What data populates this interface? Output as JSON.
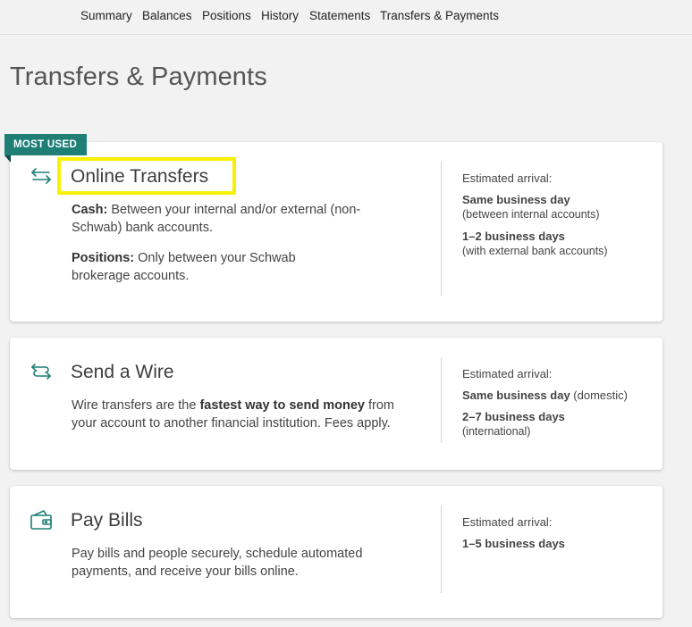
{
  "nav": {
    "items": [
      {
        "label": "Summary"
      },
      {
        "label": "Balances"
      },
      {
        "label": "Positions"
      },
      {
        "label": "History"
      },
      {
        "label": "Statements"
      },
      {
        "label": "Transfers & Payments"
      }
    ]
  },
  "page": {
    "title": "Transfers & Payments"
  },
  "accent_color": "#1f7f76",
  "highlight_color": "#f8f000",
  "cards": [
    {
      "badge": "MOST USED",
      "icon": "arrows-left-right-icon",
      "title": "Online Transfers",
      "desc1_bold": "Cash:",
      "desc1_text": " Between your internal and/or external (non-Schwab) bank accounts.",
      "desc2_bold": "Positions:",
      "desc2_text": " Only between your Schwab brokerage accounts.",
      "arrival_label": "Estimated arrival:",
      "arrival1_strong": "Same business day",
      "arrival1_sub": "(between internal accounts)",
      "arrival2_strong": "1–2 business days",
      "arrival2_sub": "(with external bank accounts)"
    },
    {
      "icon": "wire-transfer-icon",
      "title": "Send a Wire",
      "desc_pre": "Wire transfers are the ",
      "desc_bold": "fastest way to send money",
      "desc_post": " from your account to another financial institution. Fees apply.",
      "arrival_label": "Estimated arrival:",
      "arrival1_strong": "Same business day",
      "arrival1_extra": " (domestic)",
      "arrival2_strong": "2–7 business days",
      "arrival2_sub": "(international)"
    },
    {
      "icon": "wallet-icon",
      "title": "Pay Bills",
      "desc": "Pay bills and people securely, schedule automated payments, and receive your bills online.",
      "arrival_label": "Estimated arrival:",
      "arrival1_strong": "1–5 business days"
    }
  ]
}
